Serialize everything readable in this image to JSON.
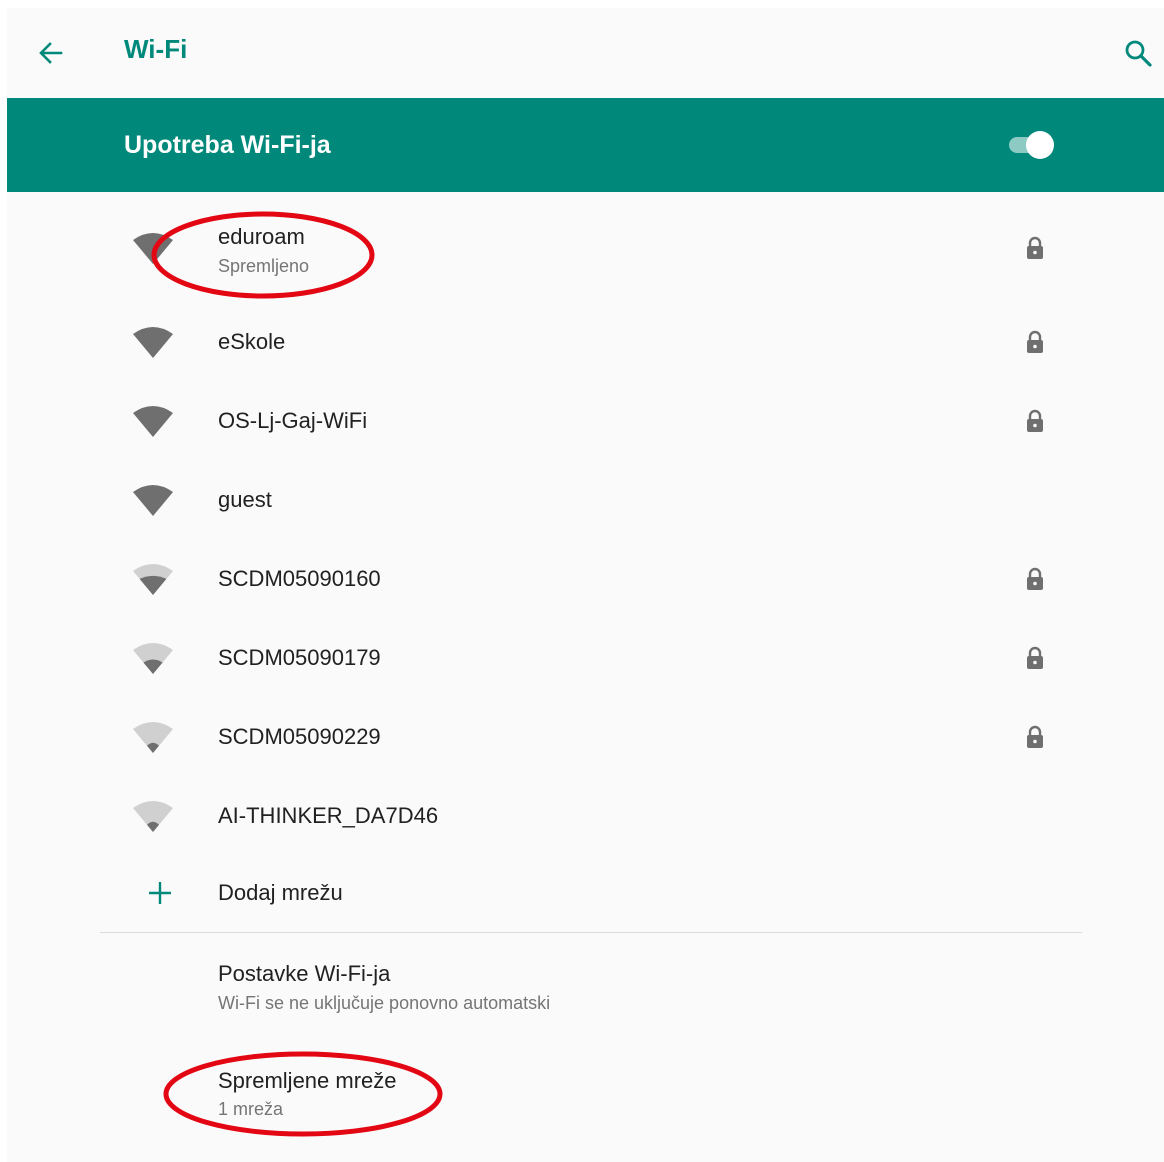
{
  "header": {
    "title": "Wi-Fi",
    "back_icon": "arrow-back-icon",
    "search_icon": "search-icon"
  },
  "master_switch": {
    "label": "Upotreba Wi-Fi-ja",
    "on": true
  },
  "networks": [
    {
      "name": "eduroam",
      "status": "Spremljeno",
      "signal": 4,
      "secured": true
    },
    {
      "name": "eSkole",
      "status": "",
      "signal": 4,
      "secured": true
    },
    {
      "name": "OS-Lj-Gaj-WiFi",
      "status": "",
      "signal": 4,
      "secured": true
    },
    {
      "name": "guest",
      "status": "",
      "signal": 4,
      "secured": false
    },
    {
      "name": "SCDM05090160",
      "status": "",
      "signal": 3,
      "secured": true
    },
    {
      "name": "SCDM05090179",
      "status": "",
      "signal": 2,
      "secured": true
    },
    {
      "name": "SCDM05090229",
      "status": "",
      "signal": 1,
      "secured": true
    },
    {
      "name": "AI-THINKER_DA7D46",
      "status": "",
      "signal": 1,
      "secured": false
    }
  ],
  "add_network": {
    "label": "Dodaj mrežu",
    "icon": "plus-icon"
  },
  "preferences": {
    "title": "Postavke Wi-Fi-ja",
    "summary": "Wi-Fi se ne uključuje ponovno automatski"
  },
  "saved_networks": {
    "title": "Spremljene mreže",
    "summary": "1 mreža"
  },
  "colors": {
    "accent": "#00897b",
    "annotation": "#e30613",
    "text_primary": "#212121",
    "text_secondary": "#757575",
    "icon": "#6f6f6f"
  }
}
